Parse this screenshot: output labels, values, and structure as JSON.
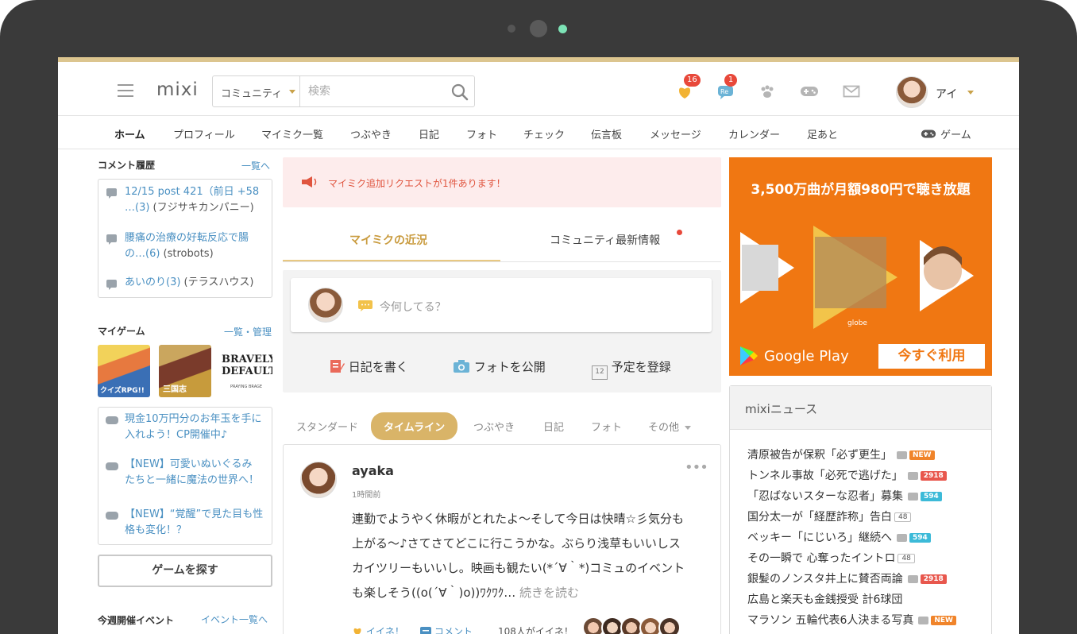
{
  "header": {
    "logo": "mixi",
    "search_scope": "コミュニティ",
    "search_placeholder": "検索",
    "notification_count": "16",
    "reply_count": "1",
    "user_name": "アイ"
  },
  "nav": {
    "items": [
      "ホーム",
      "プロフィール",
      "マイミク一覧",
      "つぶやき",
      "日記",
      "フォト",
      "チェック",
      "伝言板",
      "メッセージ",
      "カレンダー",
      "足あと"
    ],
    "game": "ゲーム"
  },
  "left": {
    "comments_title": "コメント履歴",
    "comments_link": "一覧へ",
    "comments": [
      {
        "line1": "12/15 post 421（前日 +58",
        "line2_link": "…(3)",
        "line2_gray": " (フジサキカンパニー)"
      },
      {
        "line1": "腰痛の治療の好転反応で腸",
        "line2_link": "の…(6)",
        "line2_gray": " (strobots)"
      },
      {
        "line1": "あいのり(3)",
        "line2_link": "",
        "line2_gray": " (テラスハウス)"
      }
    ],
    "mygame_title": "マイゲーム",
    "mygame_link": "一覧・管理",
    "games": [
      "クイズRPG!!",
      "三国志",
      "BRAVELY DEFAULT"
    ],
    "bravely_sub": "PRAYING BRAGE",
    "game_news": [
      {
        "line1": "現金10万円分のお年玉を手に",
        "line2": "入れよう！CP開催中♪"
      },
      {
        "line1": "【NEW】可愛いぬいぐるみ",
        "line2": "たちと一緒に魔法の世界へ！"
      },
      {
        "line1": "【NEW】“覚醒”で見た目も性",
        "line2": "格も変化！？"
      }
    ],
    "find_game_button": "ゲームを探す",
    "events_title": "今週開催イベント",
    "events_link": "イベント一覧へ"
  },
  "center": {
    "alert": "マイミク追加リクエストが1件あります！",
    "tab_friends": "マイミクの近況",
    "tab_community": "コミュニティ最新情報",
    "compose_placeholder": "今何してる？",
    "action_diary": "日記を書く",
    "action_photo": "フォトを公開",
    "action_schedule": "予定を登録",
    "calendar_num": "12",
    "filters": [
      "スタンダード",
      "タイムライン",
      "つぶやき",
      "日記",
      "フォト",
      "その他"
    ],
    "post": {
      "author": "ayaka",
      "time": "1時間前",
      "text_lines": [
        "連勤でようやく休暇がとれたよ～そして今日は快晴☆彡気分も",
        "上がる～♪さてさてどこに行こうかな。ぶらり浅草もいいしス",
        "カイツリーもいいし。映画も観たい(*´∀｀*)コミュのイベント",
        "も楽しそう((o(´∀｀)o))ﾜｸﾜｸ…"
      ],
      "read_more": "続きを読む",
      "like": "イイネ！",
      "comment": "コメント",
      "like_count": "108人がイイネ！"
    }
  },
  "right": {
    "ad_title": "3,500万曲が月額980円で聴き放題",
    "ad_caption": "globe",
    "ad_brand": "Google Play",
    "ad_button": "今すぐ利用",
    "news_title": "mixiニュース",
    "news": [
      {
        "text": "清原被告が保釈「必ず更生」",
        "photo": true,
        "badge": "NEW",
        "badge_color": "#f0842a"
      },
      {
        "text": "トンネル事故「必死で逃げた」",
        "photo": true,
        "badge": "2918",
        "badge_color": "#e8574d"
      },
      {
        "text": "「忍ばないスターな忍者」募集",
        "photo": true,
        "badge": "594",
        "badge_color": "#3cbad8"
      },
      {
        "text": "国分太一が「経歴詐称」告白",
        "photo": false,
        "count": "48"
      },
      {
        "text": "ベッキー「にじいろ」継続へ",
        "photo": true,
        "badge": "594",
        "badge_color": "#3cbad8"
      },
      {
        "text": "その一瞬で 心奪ったイントロ",
        "photo": false,
        "count": "48"
      },
      {
        "text": "銀髪のノンスタ井上に賛否両論",
        "photo": true,
        "badge": "2918",
        "badge_color": "#e8574d"
      },
      {
        "text": "広島と楽天も金銭授受 計6球団",
        "photo": false
      },
      {
        "text": "マラソン 五輪代表6人決まる写真",
        "photo": true,
        "badge": "NEW",
        "badge_color": "#f0842a"
      }
    ]
  },
  "colors": {
    "accent_gold": "#d9b468",
    "link_blue": "#4a90c2",
    "alert_red": "#e0553f",
    "ad_orange": "#f07712"
  }
}
